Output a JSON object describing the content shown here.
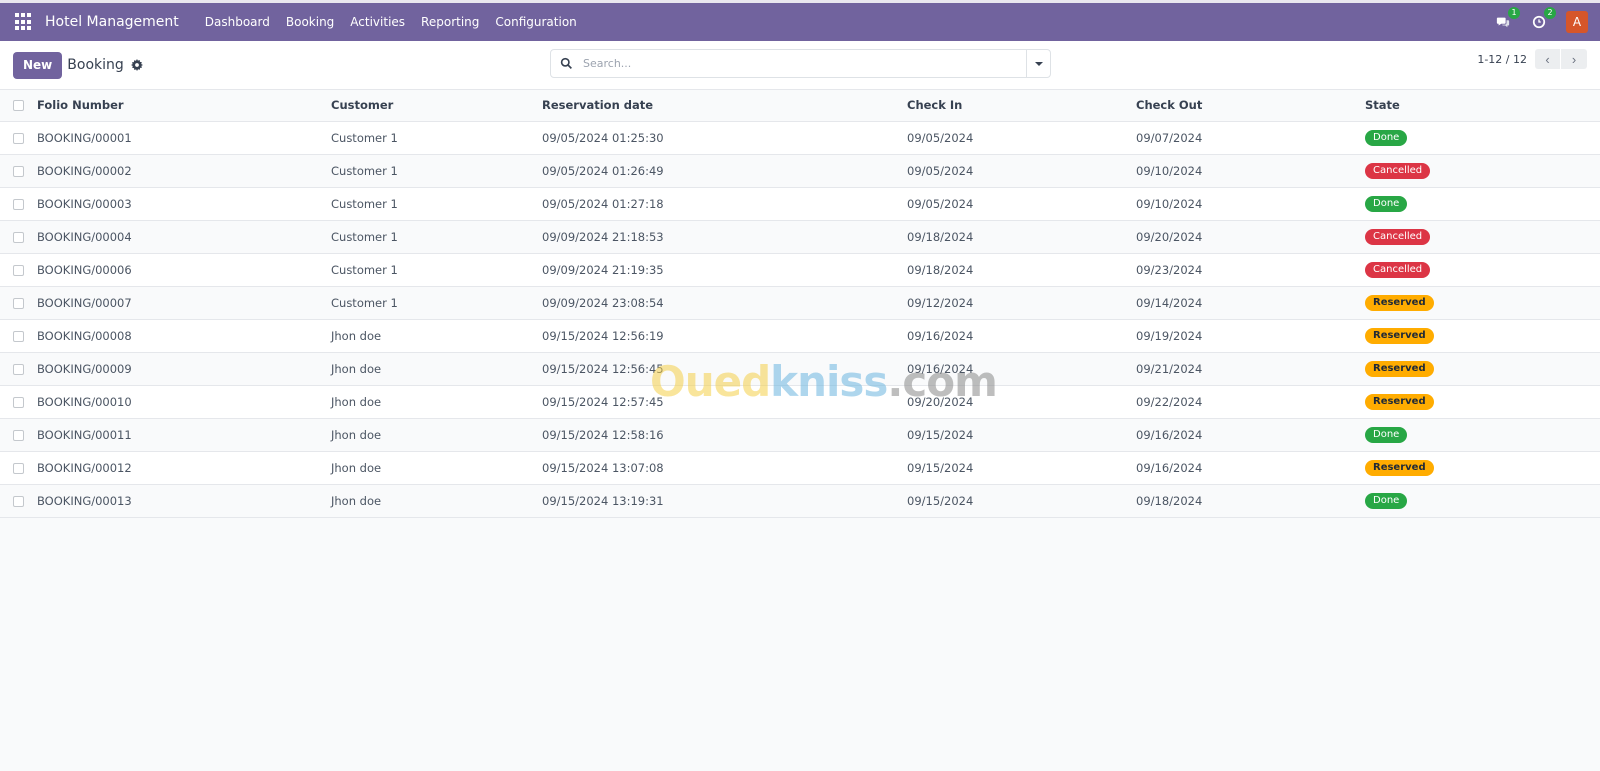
{
  "topbar": {
    "app_name": "Hotel Management",
    "menu": [
      "Dashboard",
      "Booking",
      "Activities",
      "Reporting",
      "Configuration"
    ],
    "messages_count": "1",
    "activities_count": "2",
    "avatar_initial": "A",
    "colors": {
      "brand": "#71639e",
      "avatar": "#d6562a",
      "badge": "#28a745"
    }
  },
  "control_panel": {
    "new_label": "New",
    "title": "Booking",
    "search_placeholder": "Search...",
    "search_value": "",
    "pager": "1-12 / 12"
  },
  "table": {
    "columns": [
      "Folio Number",
      "Customer",
      "Reservation date",
      "Check In",
      "Check Out",
      "State"
    ],
    "rows": [
      {
        "folio": "BOOKING/00001",
        "customer": "Customer 1",
        "reservation": "09/05/2024 01:25:30",
        "check_in": "09/05/2024",
        "check_out": "09/07/2024",
        "state": "Done",
        "state_key": "done"
      },
      {
        "folio": "BOOKING/00002",
        "customer": "Customer 1",
        "reservation": "09/05/2024 01:26:49",
        "check_in": "09/05/2024",
        "check_out": "09/10/2024",
        "state": "Cancelled",
        "state_key": "cancelled"
      },
      {
        "folio": "BOOKING/00003",
        "customer": "Customer 1",
        "reservation": "09/05/2024 01:27:18",
        "check_in": "09/05/2024",
        "check_out": "09/10/2024",
        "state": "Done",
        "state_key": "done"
      },
      {
        "folio": "BOOKING/00004",
        "customer": "Customer 1",
        "reservation": "09/09/2024 21:18:53",
        "check_in": "09/18/2024",
        "check_out": "09/20/2024",
        "state": "Cancelled",
        "state_key": "cancelled"
      },
      {
        "folio": "BOOKING/00006",
        "customer": "Customer 1",
        "reservation": "09/09/2024 21:19:35",
        "check_in": "09/18/2024",
        "check_out": "09/23/2024",
        "state": "Cancelled",
        "state_key": "cancelled"
      },
      {
        "folio": "BOOKING/00007",
        "customer": "Customer 1",
        "reservation": "09/09/2024 23:08:54",
        "check_in": "09/12/2024",
        "check_out": "09/14/2024",
        "state": "Reserved",
        "state_key": "reserved"
      },
      {
        "folio": "BOOKING/00008",
        "customer": "Jhon doe",
        "reservation": "09/15/2024 12:56:19",
        "check_in": "09/16/2024",
        "check_out": "09/19/2024",
        "state": "Reserved",
        "state_key": "reserved"
      },
      {
        "folio": "BOOKING/00009",
        "customer": "Jhon doe",
        "reservation": "09/15/2024 12:56:45",
        "check_in": "09/16/2024",
        "check_out": "09/21/2024",
        "state": "Reserved",
        "state_key": "reserved"
      },
      {
        "folio": "BOOKING/00010",
        "customer": "Jhon doe",
        "reservation": "09/15/2024 12:57:45",
        "check_in": "09/20/2024",
        "check_out": "09/22/2024",
        "state": "Reserved",
        "state_key": "reserved"
      },
      {
        "folio": "BOOKING/00011",
        "customer": "Jhon doe",
        "reservation": "09/15/2024 12:58:16",
        "check_in": "09/15/2024",
        "check_out": "09/16/2024",
        "state": "Done",
        "state_key": "done"
      },
      {
        "folio": "BOOKING/00012",
        "customer": "Jhon doe",
        "reservation": "09/15/2024 13:07:08",
        "check_in": "09/15/2024",
        "check_out": "09/16/2024",
        "state": "Reserved",
        "state_key": "reserved"
      },
      {
        "folio": "BOOKING/00013",
        "customer": "Jhon doe",
        "reservation": "09/15/2024 13:19:31",
        "check_in": "09/15/2024",
        "check_out": "09/18/2024",
        "state": "Done",
        "state_key": "done"
      }
    ],
    "state_colors": {
      "done": "#28a745",
      "cancelled": "#dc3545",
      "reserved": "#ffac00"
    }
  },
  "watermark": {
    "part1": "Oued",
    "part2": "kniss",
    "part3": ".com"
  }
}
